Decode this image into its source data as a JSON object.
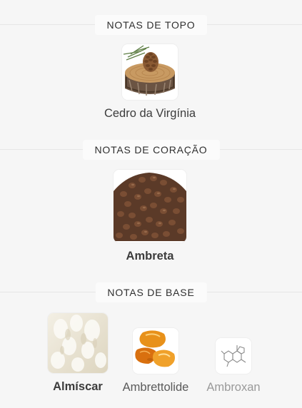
{
  "sections": {
    "top": {
      "label": "NOTAS DE TOPO"
    },
    "heart": {
      "label": "NOTAS DE CORAÇÃO"
    },
    "base": {
      "label": "NOTAS DE BASE"
    }
  },
  "notes": {
    "top": [
      {
        "name": "Cedro da Virgínia",
        "image_icon": "cedar-wood-icon"
      }
    ],
    "heart": [
      {
        "name": "Ambreta",
        "image_icon": "ambrette-seeds-icon"
      }
    ],
    "base": [
      {
        "name": "Almíscar",
        "image_icon": "musk-icon"
      },
      {
        "name": "Ambrettolide",
        "image_icon": "amber-stones-icon"
      },
      {
        "name": "Ambroxan",
        "image_icon": "molecule-icon"
      }
    ]
  }
}
